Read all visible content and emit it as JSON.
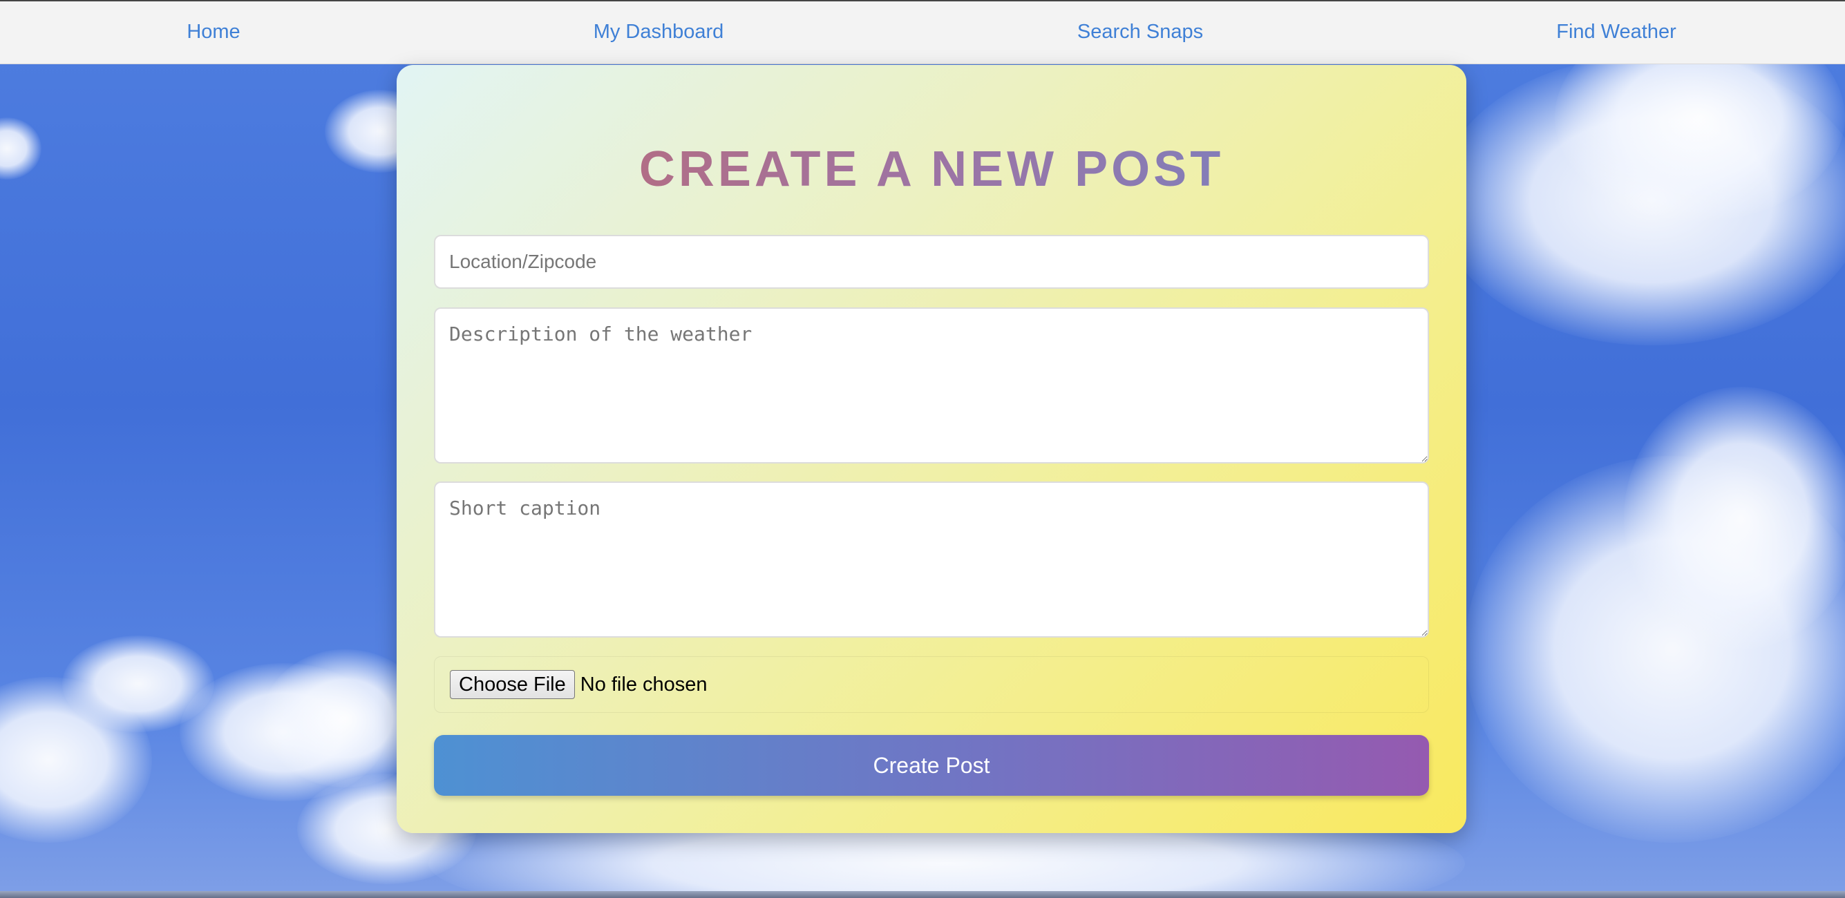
{
  "navbar": {
    "links": [
      {
        "label": "Home"
      },
      {
        "label": "My Dashboard"
      },
      {
        "label": "Search Snaps"
      },
      {
        "label": "Find Weather"
      }
    ],
    "link_color": "#3f80d6"
  },
  "form": {
    "title": "CREATE A NEW POST",
    "location_placeholder": "Location/Zipcode",
    "description_placeholder": "Description of the weather",
    "caption_placeholder": "Short caption",
    "file_button_label": "Choose File",
    "file_status": "No file chosen",
    "submit_label": "Create Post"
  },
  "colors": {
    "card_gradient_start": "#e2f4f4",
    "card_gradient_end": "#f9e95e",
    "title_gradient_start": "#c2696e",
    "title_gradient_end": "#6e85c9",
    "button_gradient_start": "#4e91d3",
    "button_gradient_end": "#955ab0",
    "sky": "#416fd8"
  }
}
